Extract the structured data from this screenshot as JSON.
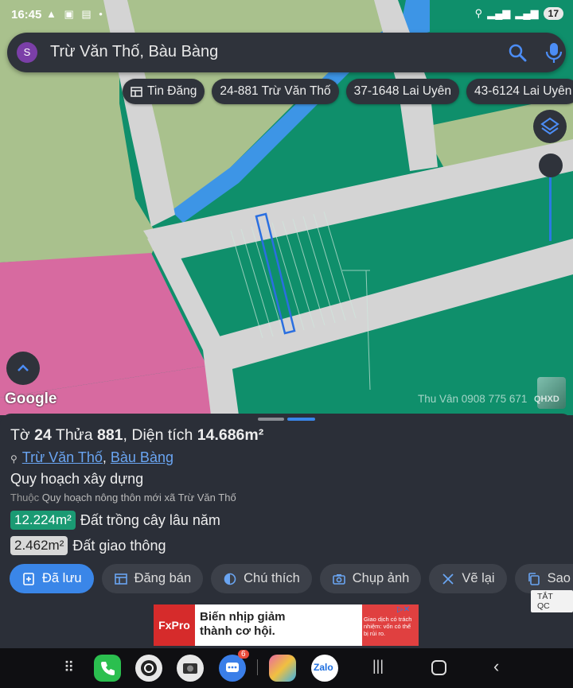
{
  "status_bar": {
    "time": "16:45",
    "battery": "17"
  },
  "search": {
    "avatar_letter": "S",
    "query": "Trừ Văn Thố, Bàu Bàng"
  },
  "chips": [
    {
      "label": "Tin Đăng",
      "icon": "listing-icon"
    },
    {
      "label": "24-881 Trừ Văn Thố"
    },
    {
      "label": "37-1648 Lai Uyên"
    },
    {
      "label": "43-6124 Lai Uyên"
    }
  ],
  "map": {
    "google_label": "Google",
    "watermark": "Thu Vân 0908 775 671",
    "thumb_label": "QHXD",
    "colors": {
      "farmland": "#0f8f6b",
      "road": "#d4d4d4",
      "residential": "#d76aa0",
      "light_green": "#a9c18d",
      "river": "#3d95e6"
    }
  },
  "parcel": {
    "sheet_prefix": "Tờ",
    "sheet_no": "24",
    "lot_prefix": "Thửa",
    "lot_no": "881",
    "area_prefix": ", Diện tích",
    "area": "14.686m²",
    "address_commune": "Trừ Văn Thố",
    "address_district": "Bàu Bàng",
    "plan_title": "Quy hoạch xây dựng",
    "plan_belongs_label": "Thuộc",
    "plan_belongs_value": "Quy hoạch nông thôn mới xã Trừ Văn Thố",
    "land_uses": [
      {
        "area": "12.224m²",
        "type": "Đất trồng cây lâu năm",
        "color": "#1a9a73"
      },
      {
        "area": "2.462m²",
        "type": "Đất giao thông",
        "color": "#d8d8d8"
      }
    ]
  },
  "actions": [
    {
      "label": "Đã lưu",
      "icon": "saved-icon"
    },
    {
      "label": "Đăng bán",
      "icon": "sell-icon"
    },
    {
      "label": "Chú thích",
      "icon": "legend-icon"
    },
    {
      "label": "Chụp ảnh",
      "icon": "camera-icon"
    },
    {
      "label": "Vẽ lại",
      "icon": "redraw-icon"
    },
    {
      "label": "Sao ch",
      "icon": "copy-icon"
    }
  ],
  "ad": {
    "close_label": "TẮT QC",
    "brand": "FxPro",
    "headline_1": "Biến nhịp giảm",
    "headline_2": "thành cơ hội.",
    "disclaimer": "Giao dịch có trách nhiệm: vốn có thể bị rủi ro."
  },
  "nav": {
    "messages_badge": "6",
    "zalo_label": "Zalo"
  }
}
